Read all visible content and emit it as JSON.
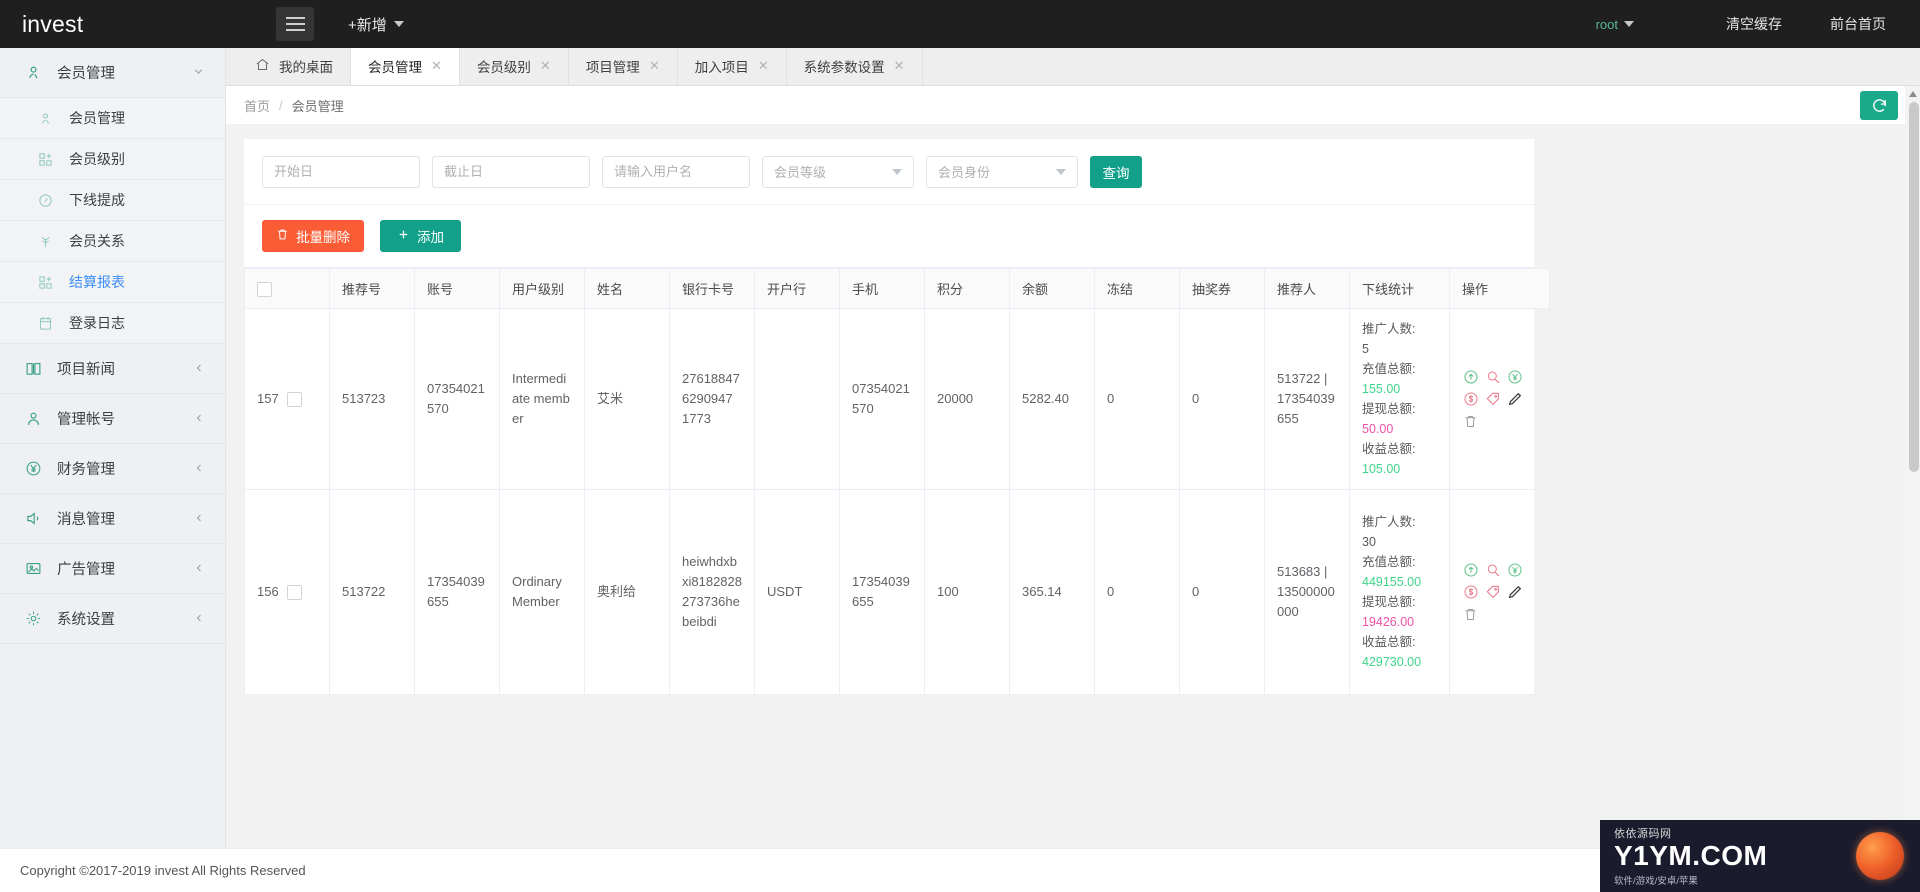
{
  "topbar": {
    "brand": "invest",
    "menu_icon": "hamburger-icon",
    "add_new": "+新增",
    "user": "root",
    "clear_cache": "清空缓存",
    "front_home": "前台首页"
  },
  "sidebar": {
    "items": [
      {
        "label": "会员管理",
        "icon": "user-icon",
        "group": true,
        "expanded": true
      },
      {
        "label": "会员管理",
        "icon": "user-icon",
        "sub": true,
        "active": false
      },
      {
        "label": "会员级别",
        "icon": "grid-icon",
        "sub": true,
        "active": false
      },
      {
        "label": "下线提成",
        "icon": "gauge-icon",
        "sub": true,
        "active": false
      },
      {
        "label": "会员关系",
        "icon": "tree-icon",
        "sub": true,
        "active": false
      },
      {
        "label": "结算报表",
        "icon": "grid-icon",
        "sub": true,
        "active": true
      },
      {
        "label": "登录日志",
        "icon": "clipboard-icon",
        "sub": true,
        "active": false
      },
      {
        "label": "项目新闻",
        "icon": "book-icon",
        "group": true,
        "expanded": false
      },
      {
        "label": "管理帐号",
        "icon": "account-icon",
        "group": true,
        "expanded": false
      },
      {
        "label": "财务管理",
        "icon": "yen-circle-icon",
        "group": true,
        "expanded": false
      },
      {
        "label": "消息管理",
        "icon": "speaker-icon",
        "group": true,
        "expanded": false
      },
      {
        "label": "广告管理",
        "icon": "image-icon",
        "group": true,
        "expanded": false
      },
      {
        "label": "系统设置",
        "icon": "gear-icon",
        "group": true,
        "expanded": false
      }
    ]
  },
  "tabs": [
    {
      "label": "我的桌面",
      "closable": false,
      "active": false,
      "icon": "home-icon"
    },
    {
      "label": "会员管理",
      "closable": true,
      "active": true
    },
    {
      "label": "会员级别",
      "closable": true,
      "active": false
    },
    {
      "label": "项目管理",
      "closable": true,
      "active": false
    },
    {
      "label": "加入项目",
      "closable": true,
      "active": false
    },
    {
      "label": "系统参数设置",
      "closable": true,
      "active": false
    }
  ],
  "breadcrumb": {
    "home": "首页",
    "separator": "/",
    "current": "会员管理",
    "refresh_icon": "refresh-icon"
  },
  "filters": {
    "start_date_placeholder": "开始日",
    "start_date_value": "",
    "end_date_placeholder": "截止日",
    "end_date_value": "",
    "username_placeholder": "请输入用户名",
    "username_value": "",
    "member_level": "会员等级",
    "member_identity": "会员身份",
    "query_label": "查询"
  },
  "actions": {
    "batch_delete": "批量删除",
    "batch_delete_icon": "trash-icon",
    "add": "添加",
    "add_icon": "plus-icon"
  },
  "table": {
    "columns": [
      "",
      "推荐号",
      "账号",
      "用户级别",
      "姓名",
      "银行卡号",
      "开户行",
      "手机",
      "积分",
      "余额",
      "冻结",
      "抽奖券",
      "推荐人",
      "下线统计",
      "操作"
    ],
    "stat_labels": {
      "promoted": "推广人数:",
      "recharge_total": "充值总额:",
      "withdraw_total": "提现总额:",
      "income_total": "收益总额:"
    },
    "op_icons": [
      "up-circle-icon",
      "search-icon",
      "yen-circle-icon",
      "dollar-circle-icon",
      "tag-icon",
      "pencil-icon",
      "trash-icon"
    ],
    "rows": [
      {
        "id": "157",
        "referral_no": "513723",
        "account": "07354021570",
        "user_level": "Intermediate member",
        "name": "艾米",
        "bank_card": "276188476290947 1773",
        "bank": "",
        "phone": "07354021570",
        "points": "20000",
        "balance": "5282.40",
        "frozen": "0",
        "lottery": "0",
        "referrer": "513722 | 17354039655",
        "promoted": "5",
        "recharge_total": "155.00",
        "withdraw_total": "50.00",
        "income_total": "105.00"
      },
      {
        "id": "156",
        "referral_no": "513722",
        "account": "17354039655",
        "user_level": "Ordinary Member",
        "name": "奥利给",
        "bank_card": "heiwhdxbxi8182828273736hebeibdi",
        "bank": "USDT",
        "phone": "17354039655",
        "points": "100",
        "balance": "365.14",
        "frozen": "0",
        "lottery": "0",
        "referrer": "513683 | 13500000000",
        "promoted": "30",
        "recharge_total": "449155.00",
        "withdraw_total": "19426.00",
        "income_total": "429730.00"
      }
    ]
  },
  "footer": {
    "copyright": "Copyright ©2017-2019 invest All Rights Reserved"
  },
  "watermark": {
    "title": "依依源码网",
    "big": "Y1YM.COM",
    "sub": "软件/游戏/安卓/苹果"
  },
  "colors": {
    "accent_green": "#12a08a",
    "danger_orange": "#fa5d35",
    "link_blue": "#3e8ef7",
    "money_green": "#3fd48a",
    "money_pink": "#ef52a8",
    "topbar_dark": "#1f1f1f"
  }
}
